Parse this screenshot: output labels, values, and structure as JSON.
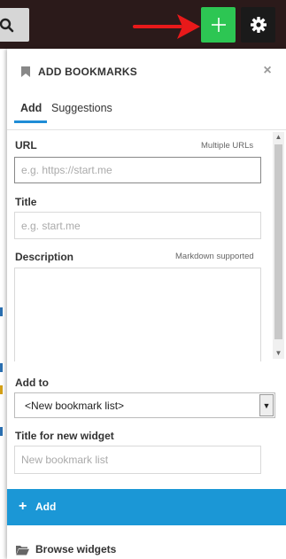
{
  "panel": {
    "title": "ADD BOOKMARKS",
    "close": "×"
  },
  "tabs": [
    {
      "label": "Add",
      "active": true
    },
    {
      "label": "Suggestions",
      "active": false
    }
  ],
  "form": {
    "url_label": "URL",
    "url_hint": "Multiple URLs",
    "url_placeholder": "e.g. https://start.me",
    "title_label": "Title",
    "title_placeholder": "e.g. start.me",
    "description_label": "Description",
    "description_hint": "Markdown supported",
    "add_to_label": "Add to",
    "add_to_value": "<New bookmark list>",
    "widget_title_label": "Title for new widget",
    "widget_title_placeholder": "New bookmark list"
  },
  "actions": {
    "add_label": "Add",
    "browse_label": "Browse widgets"
  },
  "colors": {
    "plus_button": "#2dc653",
    "add_button": "#1b97d6",
    "active_tab": "#1f8dd6",
    "arrow": "#e8191a"
  }
}
